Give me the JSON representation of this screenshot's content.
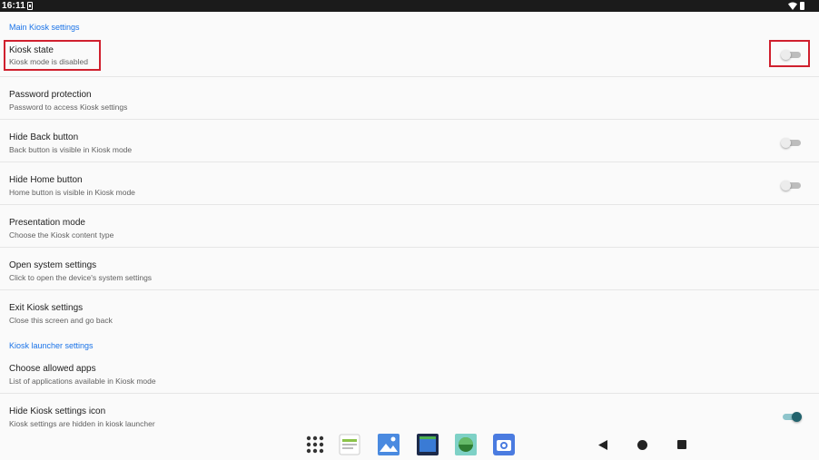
{
  "status_bar": {
    "time": "16:11"
  },
  "sections": {
    "main_header": "Main Kiosk settings",
    "launcher_header": "Kiosk launcher settings"
  },
  "prefs": {
    "kiosk_state": {
      "title": "Kiosk state",
      "summary": "Kiosk mode is disabled",
      "switch_on": false
    },
    "password": {
      "title": "Password protection",
      "summary": "Password to access Kiosk settings"
    },
    "hide_back": {
      "title": "Hide Back button",
      "summary": "Back button is visible in Kiosk mode",
      "switch_on": false
    },
    "hide_home": {
      "title": "Hide Home button",
      "summary": "Home button is visible in Kiosk mode",
      "switch_on": false
    },
    "presentation": {
      "title": "Presentation mode",
      "summary": "Choose the Kiosk content type"
    },
    "system_settings": {
      "title": "Open system settings",
      "summary": "Click to open the device's system settings"
    },
    "exit": {
      "title": "Exit Kiosk settings",
      "summary": "Close this screen and go back"
    },
    "allowed_apps": {
      "title": "Choose allowed apps",
      "summary": "List of applications available in Kiosk mode"
    },
    "hide_icon": {
      "title": "Hide Kiosk settings icon",
      "summary": "Kiosk settings are hidden in kiosk launcher",
      "switch_on": true
    }
  },
  "dock": {
    "icons": [
      "app-drawer-icon",
      "notepad-app-icon",
      "gallery-app-icon",
      "file-manager-app-icon",
      "game-app-icon",
      "camera-app-icon"
    ]
  },
  "nav": {
    "icons": [
      "back-icon",
      "home-icon",
      "recents-icon"
    ]
  },
  "colors": {
    "accent": "#1a73e8",
    "switch_on": "#22636d",
    "highlight": "#d0202e"
  }
}
